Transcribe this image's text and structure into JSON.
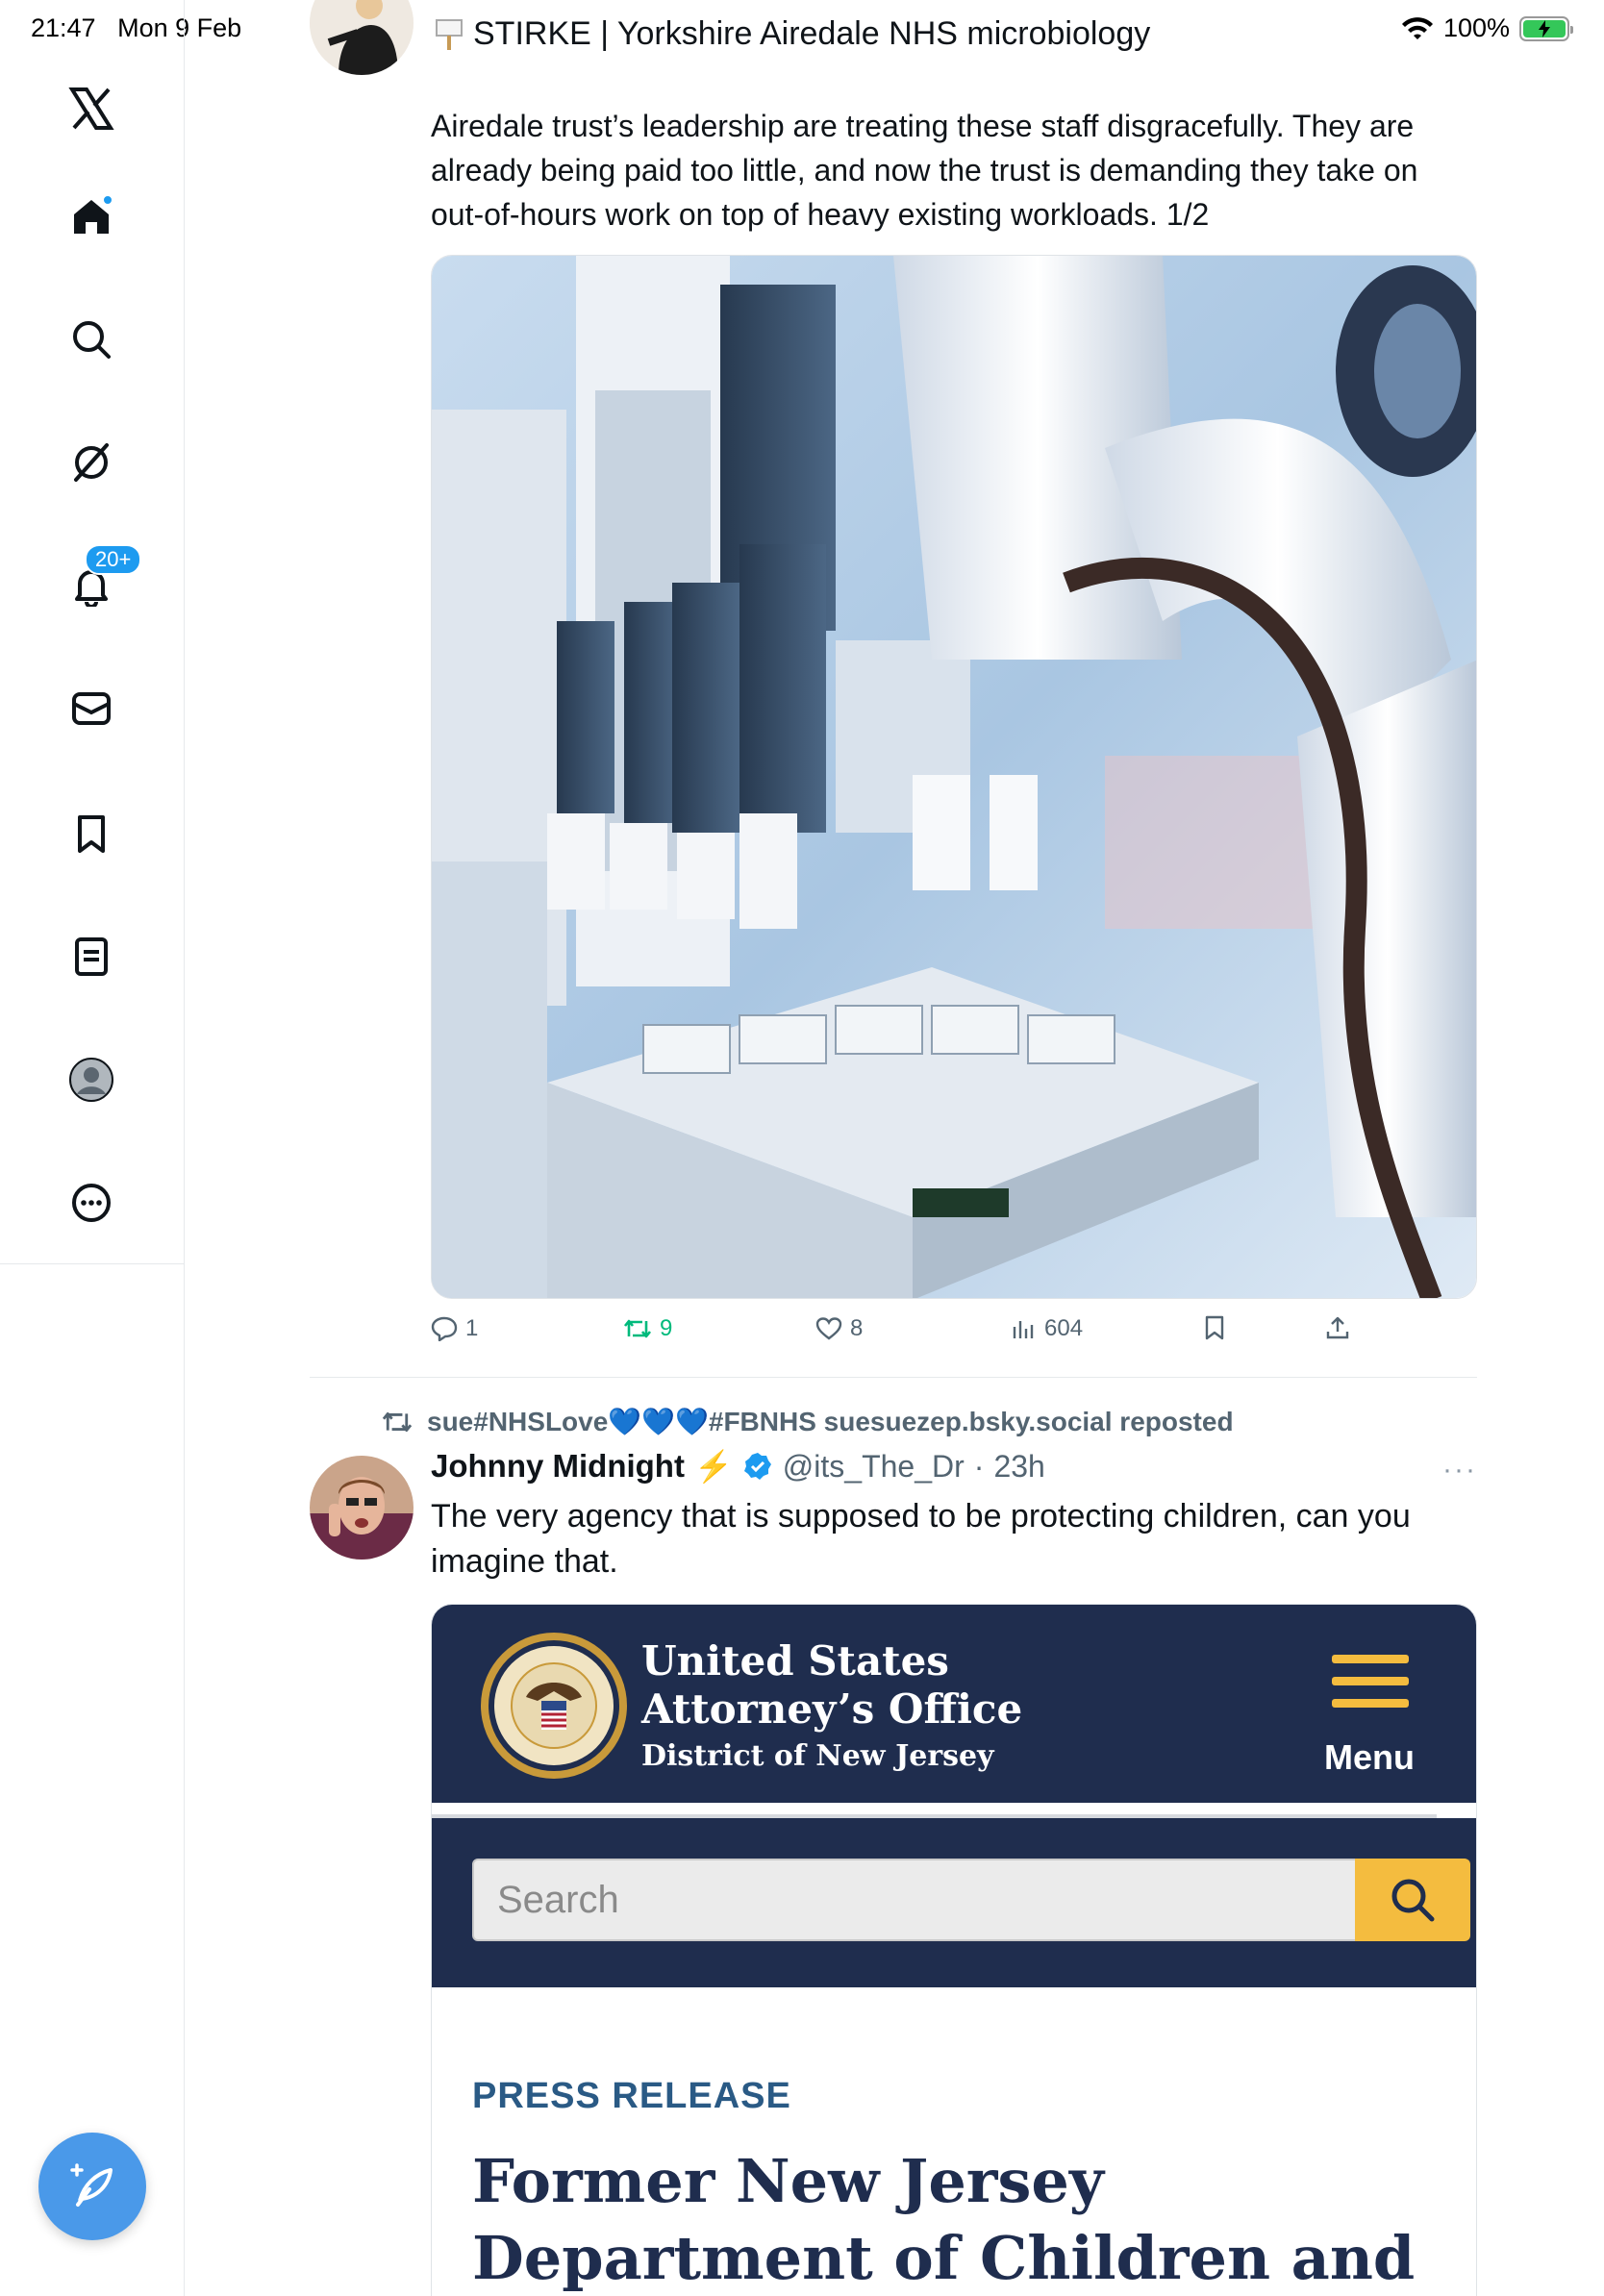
{
  "status_bar": {
    "time": "21:47",
    "date": "Mon 9 Feb",
    "battery": "100%"
  },
  "sidebar": {
    "items": [
      {
        "name": "x-logo"
      },
      {
        "name": "home",
        "has_dot": true
      },
      {
        "name": "search"
      },
      {
        "name": "grok"
      },
      {
        "name": "notifications",
        "badge": "20+"
      },
      {
        "name": "messages"
      },
      {
        "name": "bookmarks"
      },
      {
        "name": "lists"
      },
      {
        "name": "profile"
      },
      {
        "name": "more"
      }
    ],
    "compose": "compose-post"
  },
  "post1": {
    "header_text": "STIRKE | Yorkshire Airedale NHS microbiology",
    "text": "Airedale trust’s leadership are treating these staff disgracefully. They are already being paid too little, and now the trust is demanding they take on out-of-hours work on top of heavy existing workloads. 1/2",
    "image_alt": "laboratory robot",
    "replies": "1",
    "reposts": "9",
    "likes": "8",
    "views": "604"
  },
  "post2": {
    "repost_by": "sue#NHSLove💙💙💙#FBNHS suesuezep.bsky.social reposted",
    "author_name": "Johnny Midnight",
    "author_emoji": "⚡",
    "handle": "@its_The_Dr",
    "separator": "·",
    "time": "23h",
    "more": "···",
    "text": "The very agency that is supposed to be protecting children, can you imagine that."
  },
  "card": {
    "org_line1": "United States",
    "org_line2": "Attorney’s Office",
    "org_sub": "District of New Jersey",
    "menu_label": "Menu",
    "search_placeholder": "Search",
    "press_label": "PRESS RELEASE",
    "headline": "Former New Jersey Department of Children and Family Services"
  },
  "colors": {
    "accent": "#1d9bf0",
    "repost_green": "#00ba7c",
    "doj_navy": "#1f2d4e",
    "doj_gold": "#f4bc3f"
  }
}
